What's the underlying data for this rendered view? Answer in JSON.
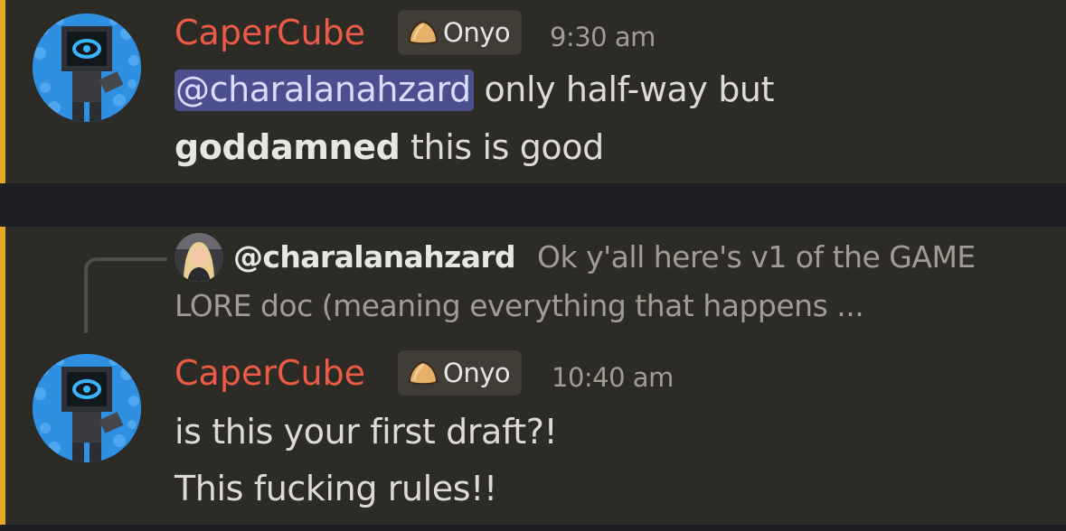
{
  "colors": {
    "accent_bar": "#e7a823",
    "username": "#ed5a45",
    "mention_bg": "#4c4f8e",
    "message_bg": "#2d2b26",
    "separator_bg": "#1e1f22"
  },
  "messages": [
    {
      "author": "CaperCube",
      "role_icon": "onyo-dumpling-icon",
      "role": "Onyo",
      "timestamp": "9:30 am",
      "mention": "@charalanahzard",
      "line1_rest": " only half-way but",
      "line2_bold": "goddamned",
      "line2_rest": " this is good"
    },
    {
      "reply": {
        "author": "@charalanahzard",
        "text_line1": "Ok y'all here's v1 of the GAME",
        "text_line2": "LORE doc (meaning everything that happens ..."
      },
      "author": "CaperCube",
      "role_icon": "onyo-dumpling-icon",
      "role": "Onyo",
      "timestamp": "10:40 am",
      "line1": "is this your first draft?!",
      "line2": "This fucking rules!!"
    }
  ]
}
